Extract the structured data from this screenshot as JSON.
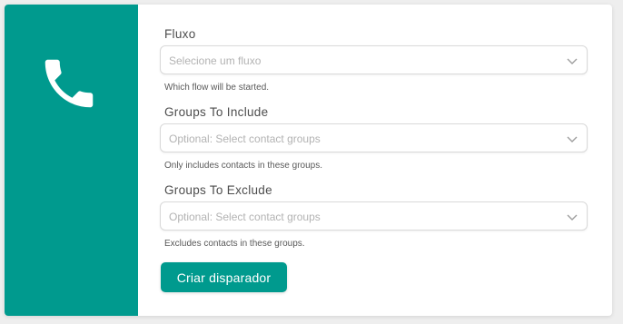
{
  "panel": {
    "accent_color": "#009a8e",
    "icon": "phone-icon"
  },
  "fields": [
    {
      "label": "Fluxo",
      "placeholder": "Selecione um fluxo",
      "help": "Which flow will be started."
    },
    {
      "label": "Groups To Include",
      "placeholder": "Optional: Select contact groups",
      "help": "Only includes contacts in these groups."
    },
    {
      "label": "Groups To Exclude",
      "placeholder": "Optional: Select contact groups",
      "help": "Excludes contacts in these groups."
    }
  ],
  "submit_label": "Criar disparador"
}
